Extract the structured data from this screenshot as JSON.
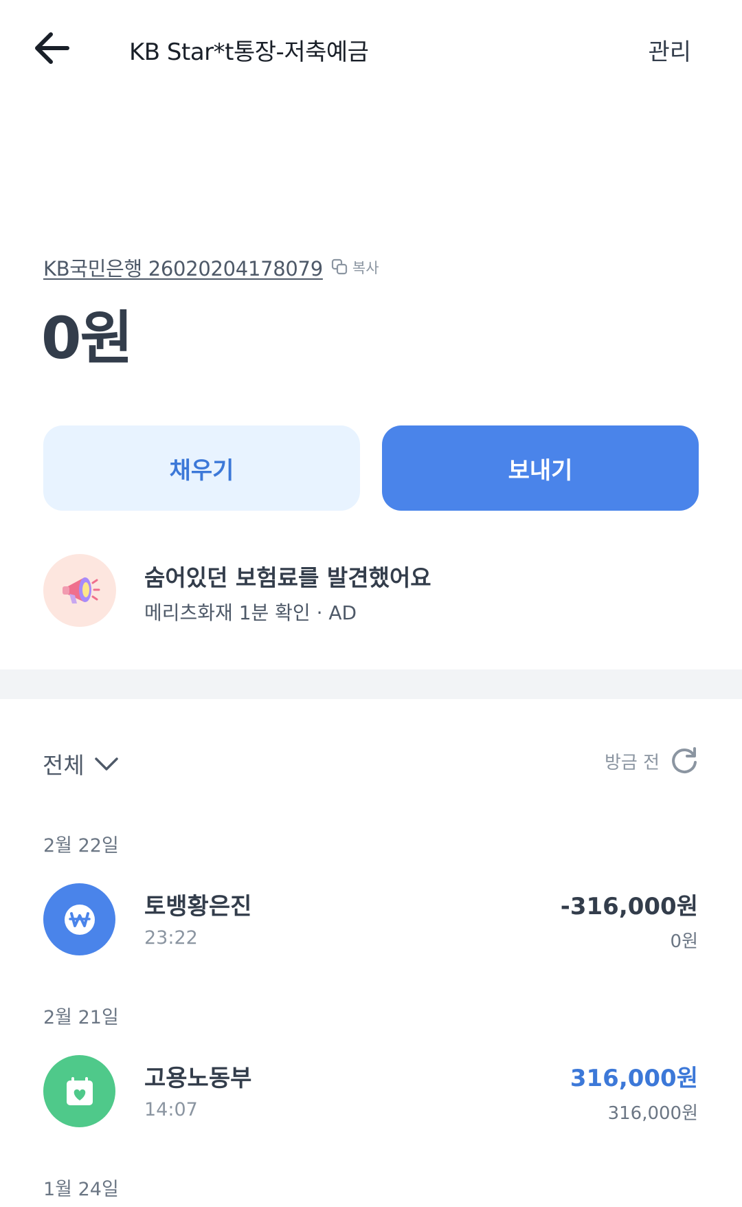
{
  "header": {
    "title": "KB Star*t통장-저축예금",
    "manage_label": "관리"
  },
  "account": {
    "line": "KB국민은행 26020204178079",
    "copy_label": "복사",
    "balance": "0원"
  },
  "actions": {
    "fill_label": "채우기",
    "send_label": "보내기"
  },
  "ad": {
    "title": "숨어있던 보험료를 발견했어요",
    "subtitle": "메리츠화재 1분 확인 · AD"
  },
  "filter": {
    "label": "전체",
    "refresh_label": "방금 전"
  },
  "transactions": {
    "groups": [
      {
        "date": "2월 22일",
        "items": [
          {
            "name": "토뱅황은진",
            "time": "23:22",
            "amount": "-316,000원",
            "balance_after": "0원",
            "icon": "won-icon",
            "icon_color": "#4a84ea",
            "amount_color": "#333d4b"
          }
        ]
      },
      {
        "date": "2월 21일",
        "items": [
          {
            "name": "고용노동부",
            "time": "14:07",
            "amount": "316,000원",
            "balance_after": "316,000원",
            "icon": "calendar-heart-icon",
            "icon_color": "#4fc98a",
            "amount_color": "#3c78d8"
          }
        ]
      },
      {
        "date": "1월 24일",
        "items": []
      }
    ]
  },
  "colors": {
    "primary": "#4a84ea",
    "primary_light": "#e8f3ff",
    "deposit": "#3c78d8",
    "divider": "#f2f4f6"
  }
}
